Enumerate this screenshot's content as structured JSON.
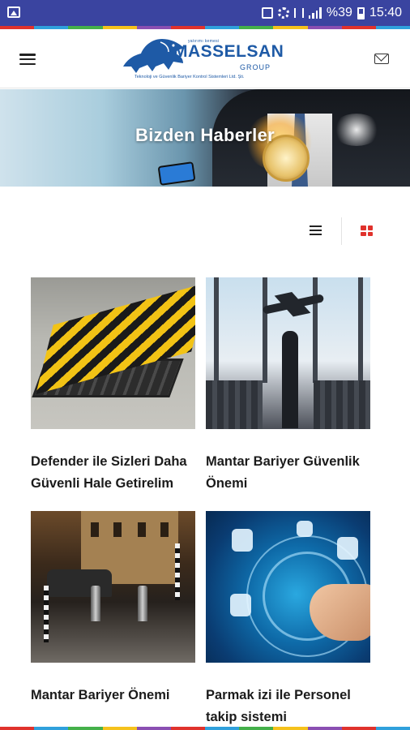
{
  "status_bar": {
    "battery_percent": "%39",
    "time": "15:40",
    "icons": [
      "image-icon",
      "lock-icon",
      "gear-icon",
      "vibrate-icon",
      "signal-icon",
      "battery-icon"
    ]
  },
  "colors": {
    "status_bar_bg": "#3a44a0",
    "brand_blue": "#1e5aa6",
    "grid_icon_active": "#e0322c",
    "rainbow": [
      "#e0322c",
      "#2fa0dc",
      "#44b04a",
      "#f5c21b",
      "#8a4fb2",
      "#e0322c",
      "#2fa0dc",
      "#44b04a",
      "#f5c21b",
      "#8a4fb2",
      "#e0322c",
      "#2fa0dc"
    ]
  },
  "header": {
    "menu_icon": "hamburger-icon",
    "contact_icon": "mail-icon",
    "logo": {
      "small_top": "yatırımı kemesi",
      "brand": "MASSELSAN",
      "group": "GROUP",
      "tagline": "Teknoloji ve Güvenlik Bariyer Kontrol Sistemleri Ltd. Şti."
    }
  },
  "banner": {
    "title": "Bizden Haberler"
  },
  "view_toggle": {
    "list_icon": "list-view-icon",
    "grid_icon": "grid-view-icon",
    "active": "grid"
  },
  "news": [
    {
      "title": "Defender ile Sizleri Daha Güvenli Hale Getirelim"
    },
    {
      "title": "Mantar Bariyer Güvenlik Önemi"
    },
    {
      "title": "Mantar Bariyer Önemi"
    },
    {
      "title": "Parmak izi ile Personel takip sistemi"
    }
  ]
}
